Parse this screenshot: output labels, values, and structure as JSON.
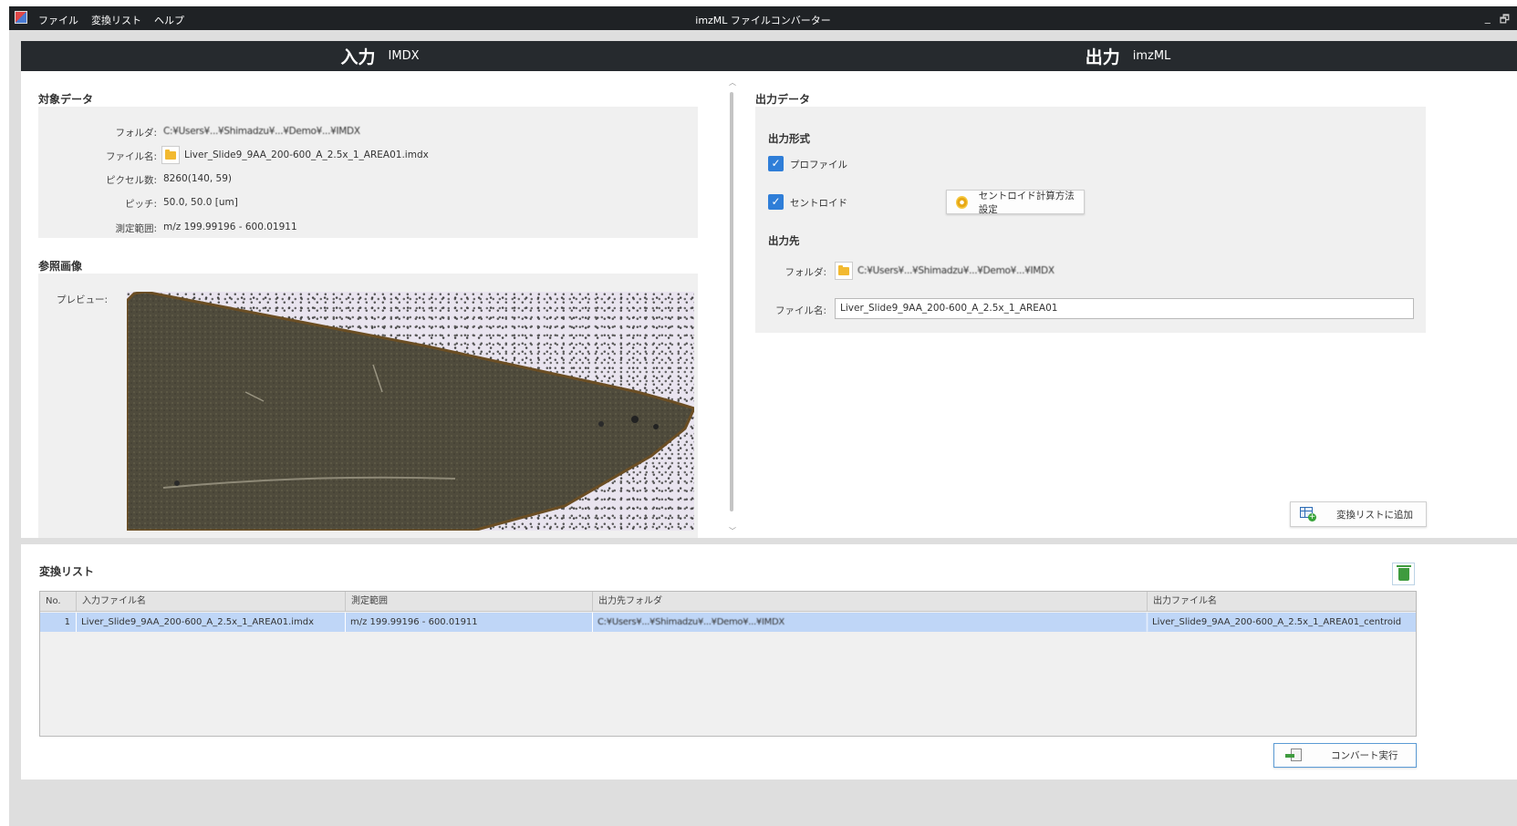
{
  "window": {
    "title": "imzML ファイルコンバーター",
    "menu": [
      "ファイル",
      "変換リスト",
      "ヘルプ"
    ],
    "controls": [
      "_",
      "🗗"
    ]
  },
  "input_panel": {
    "title": "入力",
    "subtitle": "IMDX",
    "target_section": "対象データ",
    "rows": {
      "folder_label": "フォルダ:",
      "folder_value": "C:¥Users¥...¥Shimadzu¥...¥Demo¥...¥IMDX",
      "filename_label": "ファイル名:",
      "filename_value": "Liver_Slide9_9AA_200-600_A_2.5x_1_AREA01.imdx",
      "pixels_label": "ピクセル数:",
      "pixels_value": "8260(140, 59)",
      "pitch_label": "ピッチ:",
      "pitch_value": "50.0, 50.0 [um]",
      "range_label": "測定範囲:",
      "range_value": "m/z 199.99196 - 600.01911"
    },
    "reference_section": "参照画像",
    "preview_label": "プレビュー:"
  },
  "output_panel": {
    "title": "出力",
    "subtitle": "imzML",
    "output_section": "出力データ",
    "format_label": "出力形式",
    "profile_label": "プロファイル",
    "profile_checked": true,
    "centroid_label": "セントロイド",
    "centroid_checked": true,
    "centroid_settings_button": "セントロイド計算方法設定",
    "dest_label": "出力先",
    "folder_label": "フォルダ:",
    "folder_value": "C:¥Users¥...¥Shimadzu¥...¥Demo¥...¥IMDX",
    "filename_label": "ファイル名:",
    "filename_value": "Liver_Slide9_9AA_200-600_A_2.5x_1_AREA01",
    "add_button": "変換リストに追加"
  },
  "conversion_list": {
    "title": "変換リスト",
    "columns": [
      "No.",
      "入力ファイル名",
      "測定範囲",
      "出力先フォルダ",
      "出力ファイル名"
    ],
    "rows": [
      {
        "no": "1",
        "input": "Liver_Slide9_9AA_200-600_A_2.5x_1_AREA01.imdx",
        "range": "m/z 199.99196 - 600.01911",
        "folder": "C:¥Users¥...¥Shimadzu¥...¥Demo¥...¥IMDX",
        "output": "Liver_Slide9_9AA_200-600_A_2.5x_1_AREA01_centroid"
      }
    ],
    "convert_button": "コンバート実行"
  },
  "colors": {
    "header_bg": "#262a2e",
    "checkbox": "#2f7ed8",
    "row_selected": "#bfd6f7"
  }
}
